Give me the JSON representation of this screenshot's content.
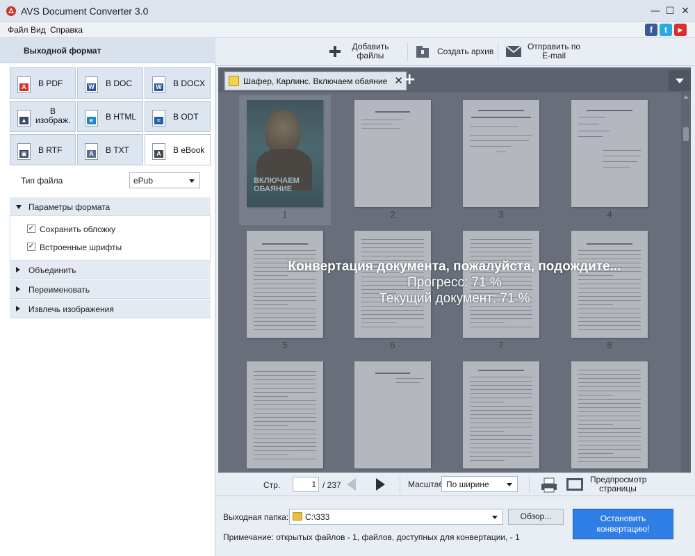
{
  "window": {
    "title": "AVS Document Converter 3.0",
    "controls": [
      "—",
      "☐",
      "✕"
    ]
  },
  "menu": [
    "Файл",
    "Вид",
    "Справка"
  ],
  "social": [
    {
      "name": "facebook",
      "glyph": "f",
      "color": "#3b5998"
    },
    {
      "name": "twitter",
      "glyph": "t",
      "color": "#27a9e1"
    },
    {
      "name": "youtube",
      "glyph": "▶",
      "color": "#d9302c"
    }
  ],
  "left_panel": {
    "header": "Выходной формат",
    "formats": [
      {
        "label": "В PDF",
        "icon": "pdf-icon",
        "color": "#d9302c",
        "tag": "A"
      },
      {
        "label": "В DOC",
        "icon": "doc-icon",
        "color": "#2b5797",
        "tag": "W"
      },
      {
        "label": "В DOCX",
        "icon": "docx-icon",
        "color": "#2b5797",
        "tag": "W"
      },
      {
        "label": "В изображ.",
        "icon": "image-icon",
        "color": "#3a4a66",
        "tag": "▲"
      },
      {
        "label": "В HTML",
        "icon": "html-icon",
        "color": "#1e88c7",
        "tag": "e"
      },
      {
        "label": "В ODT",
        "icon": "odt-icon",
        "color": "#1e5fa8",
        "tag": "≈"
      },
      {
        "label": "В RTF",
        "icon": "rtf-icon",
        "color": "#3a4a66",
        "tag": "▣"
      },
      {
        "label": "В TXT",
        "icon": "txt-icon",
        "color": "#5a6c8a",
        "tag": "A"
      },
      {
        "label": "В eBook",
        "icon": "ebook-icon",
        "color": "#4a4a4a",
        "tag": "A",
        "active": true
      }
    ],
    "file_type_label": "Тип файла",
    "file_type_value": "ePub",
    "format_params": "Параметры формата",
    "options": [
      {
        "label": "Сохранить обложку",
        "checked": true
      },
      {
        "label": "Встроенные шрифты",
        "checked": true
      }
    ],
    "collapsed_sections": [
      "Объединить",
      "Переименовать",
      "Извлечь изображения"
    ]
  },
  "toolbar": {
    "add_files": [
      "Добавить",
      "файлы"
    ],
    "create_archive": "Создать архив",
    "send_email": [
      "Отправить по",
      "E-mail"
    ]
  },
  "tab": {
    "title": "Шафер, Карлинс. Включаем обаяние ..."
  },
  "pages": [
    "1",
    "2",
    "3",
    "4",
    "5",
    "6",
    "7",
    "8"
  ],
  "cover_text": [
    "ВКЛЮЧАЕМ",
    "ОБАЯНИЕ"
  ],
  "overlay": {
    "headline": "Конвертация документа, пожалуйста, подождите...",
    "progress": "Прогресс: 71 %",
    "current": "Текущий документ: 71 %",
    "progress_value": 71
  },
  "navigation": {
    "page_label": "Стр.",
    "page_value": "1",
    "page_total": "/ 237",
    "zoom_label": "Масштаб",
    "zoom_value": "По ширине",
    "preview_label": [
      "Предпросмотр",
      "страницы"
    ]
  },
  "bottom": {
    "output_label": "Выходная папка:",
    "output_path": "C:\\333",
    "browse": "Обзор...",
    "stop": [
      "Остановить",
      "конвертацию!"
    ],
    "note": "Примечание: открытых файлов - 1, файлов, доступных для конвертации, - 1"
  }
}
